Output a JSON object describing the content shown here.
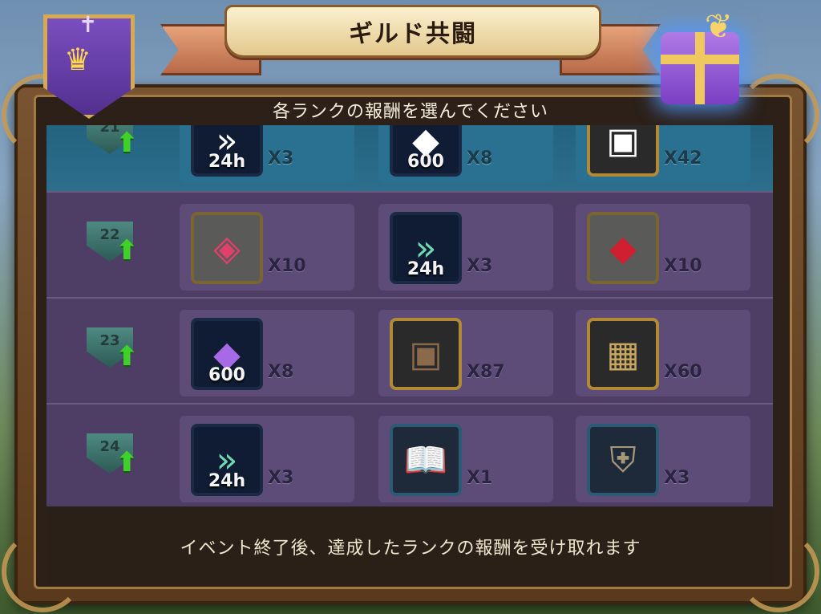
{
  "title": "ギルド共闘",
  "subtitle": "各ランクの報酬を選んでください",
  "footer": "イベント終了後、達成したランクの報酬を受け取れます",
  "rows": [
    {
      "rank": "21",
      "items": [
        {
          "icon": "speedup-icon",
          "label": "24h",
          "qty": "X3"
        },
        {
          "icon": "crystal-icon",
          "label": "600",
          "qty": "X8"
        },
        {
          "icon": "chest-icon",
          "label": "",
          "qty": "X42"
        }
      ]
    },
    {
      "rank": "22",
      "items": [
        {
          "icon": "pink-gem-icon",
          "label": "",
          "qty": "X10"
        },
        {
          "icon": "speedup-icon",
          "label": "24h",
          "qty": "X3"
        },
        {
          "icon": "red-gem-icon",
          "label": "",
          "qty": "X10"
        }
      ]
    },
    {
      "rank": "23",
      "items": [
        {
          "icon": "crystal-icon",
          "label": "600",
          "qty": "X8"
        },
        {
          "icon": "chest-icon",
          "label": "",
          "qty": "X87"
        },
        {
          "icon": "beast-chest-icon",
          "label": "",
          "qty": "X60"
        }
      ]
    },
    {
      "rank": "24",
      "items": [
        {
          "icon": "speedup-icon",
          "label": "24h",
          "qty": "X3"
        },
        {
          "icon": "tome-icon",
          "label": "",
          "qty": "X1"
        },
        {
          "icon": "armor-icon",
          "label": "",
          "qty": "X3"
        }
      ]
    }
  ],
  "colors": {
    "list_bg": "#4e3e66",
    "highlight_row": "#2a7090",
    "rank_arrow": "#3fd12a"
  }
}
